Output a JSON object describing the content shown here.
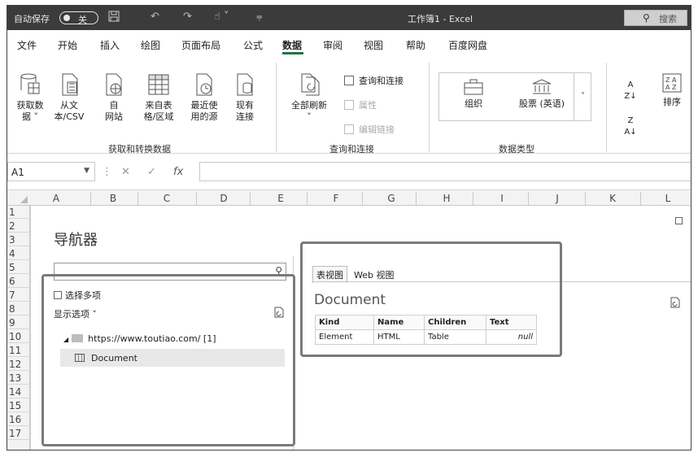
{
  "titlebar": {
    "autosave_label": "自动保存",
    "autosave_state": "关",
    "filename": "工作簿1 - Excel",
    "search_placeholder": "搜索"
  },
  "menu": {
    "tabs": [
      "文件",
      "开始",
      "插入",
      "绘图",
      "页面布局",
      "公式",
      "数据",
      "审阅",
      "视图",
      "帮助",
      "百度网盘"
    ],
    "active": "数据"
  },
  "ribbon": {
    "get_transform": {
      "label": "获取和转换数据",
      "buttons": [
        {
          "line1": "获取数",
          "line2": "据 ˅"
        },
        {
          "line1": "从文",
          "line2": "本/CSV"
        },
        {
          "line1": "自",
          "line2": "网站"
        },
        {
          "line1": "来自表",
          "line2": "格/区域"
        },
        {
          "line1": "最近使",
          "line2": "用的源"
        },
        {
          "line1": "现有",
          "line2": "连接"
        }
      ]
    },
    "queries": {
      "label": "查询和连接",
      "refresh_all": "全部刷新",
      "queries_connections": "查询和连接",
      "properties": "属性",
      "edit_links": "编辑链接"
    },
    "data_types": {
      "label": "数据类型",
      "org": "组织",
      "stocks": "股票 (英语)"
    },
    "sort": {
      "sort_label": "排序"
    }
  },
  "formula_bar": {
    "name_box": "A1",
    "fx": "fx"
  },
  "grid": {
    "columns": [
      "A",
      "B",
      "C",
      "D",
      "E",
      "F",
      "G",
      "H",
      "I",
      "J",
      "K",
      "L"
    ],
    "rows": [
      "1",
      "2",
      "3",
      "4",
      "5",
      "6",
      "7",
      "8",
      "9",
      "10",
      "11",
      "12",
      "13",
      "14",
      "15",
      "16",
      "17"
    ]
  },
  "navigator": {
    "title": "导航器",
    "select_multiple": "选择多项",
    "display_options": "显示选项 ˅",
    "source_url": "https://www.toutiao.com/ [1]",
    "document_item": "Document",
    "tab_table_view": "表视图",
    "tab_web_view": "Web 视图",
    "preview_title": "Document",
    "table": {
      "headers": [
        "Kind",
        "Name",
        "Children",
        "Text"
      ],
      "rows": [
        [
          "Element",
          "HTML",
          "Table",
          "null"
        ]
      ]
    }
  }
}
